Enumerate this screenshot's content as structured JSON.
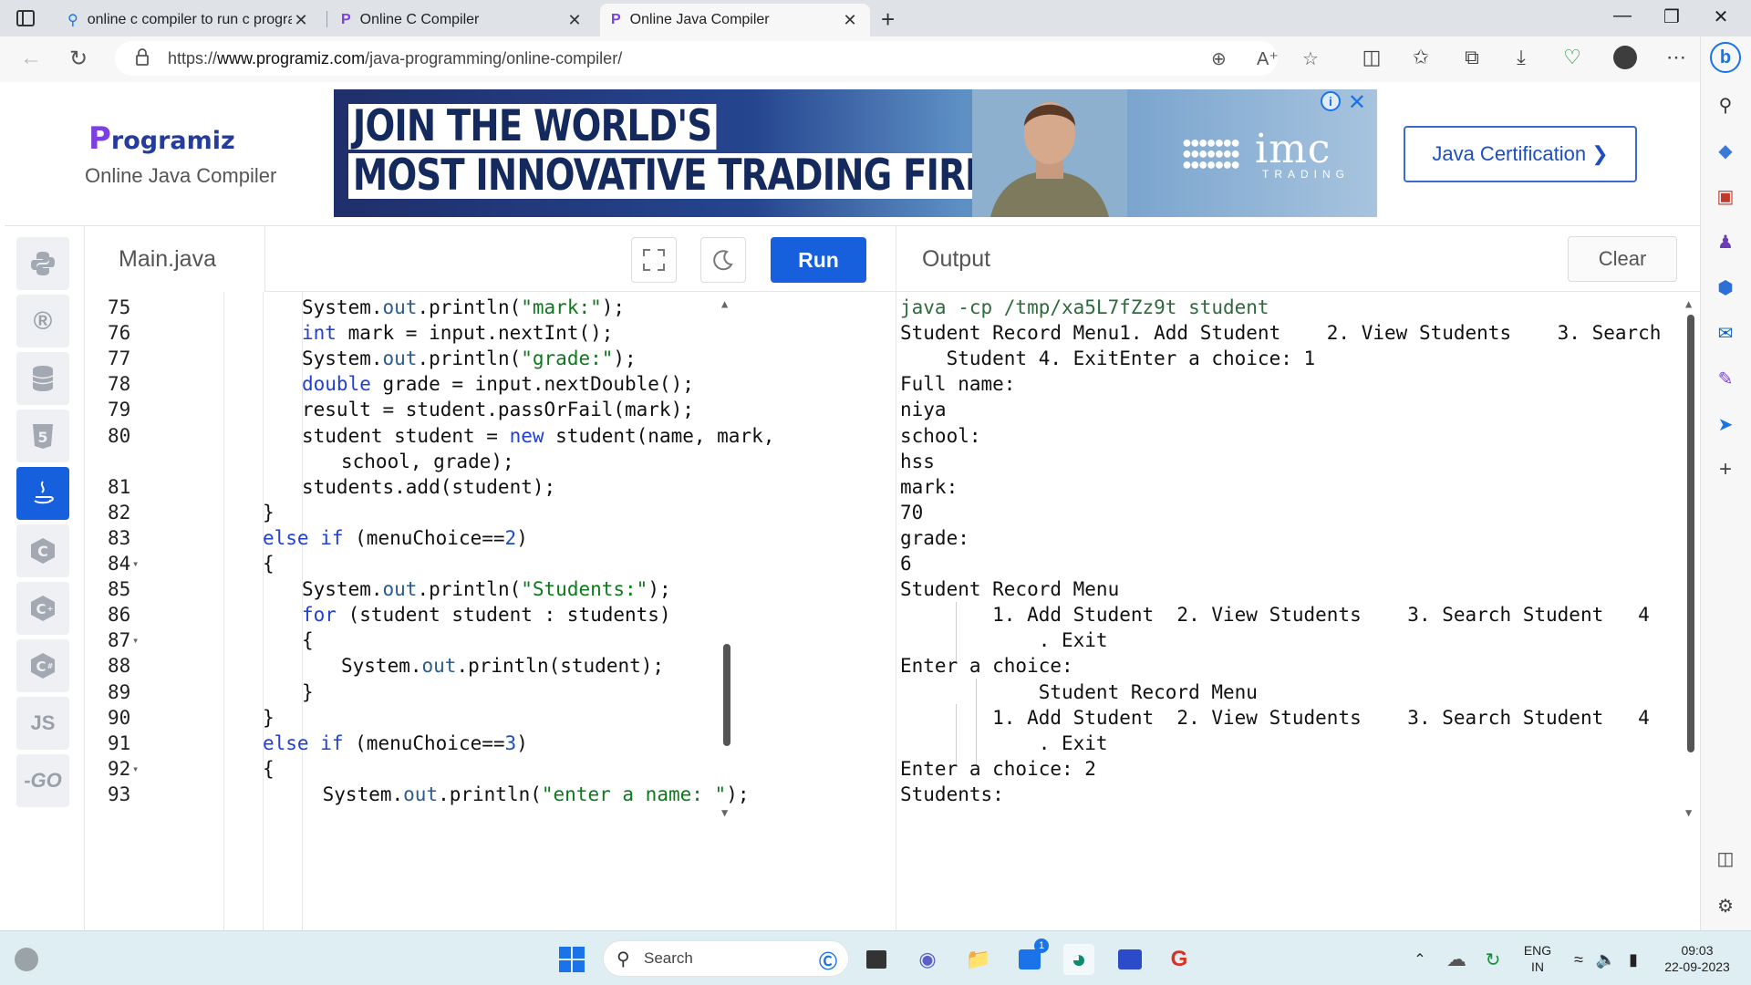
{
  "browser": {
    "tabs": [
      {
        "title": "online c compiler to run c progra",
        "close": "✕"
      },
      {
        "title": "Online C Compiler",
        "close": "✕"
      },
      {
        "title": "Online Java Compiler",
        "close": "✕"
      }
    ],
    "new_tab": "+",
    "url_prefix": "https://",
    "url_host": "www.programiz.com",
    "url_path": "/java-programming/online-compiler/",
    "window": {
      "minimize": "—",
      "maximize": "❐",
      "close": "✕"
    }
  },
  "header": {
    "logo_p": "P",
    "logo_rest": "rogramiz",
    "subtitle": "Online Java Compiler",
    "ad": {
      "line1": "JOIN THE WORLD'S",
      "line2": "MOST INNOVATIVE TRADING FIRM",
      "brand": "imc",
      "brand_sub": "TRADING",
      "info": "i",
      "close": "✕"
    },
    "cert_button": "Java Certification ❯"
  },
  "languages": [
    "python",
    "r",
    "sql",
    "html5",
    "java",
    "c",
    "cpp",
    "csharp",
    "js",
    "go"
  ],
  "lang_labels": {
    "js": "JS",
    "go": "-GO"
  },
  "editor": {
    "filename": "Main.java",
    "run_label": "Run",
    "lines": [
      {
        "num": "75",
        "fold": ""
      },
      {
        "num": "76",
        "fold": ""
      },
      {
        "num": "77",
        "fold": ""
      },
      {
        "num": "78",
        "fold": ""
      },
      {
        "num": "79",
        "fold": ""
      },
      {
        "num": "80",
        "fold": ""
      },
      {
        "num": "",
        "fold": ""
      },
      {
        "num": "81",
        "fold": ""
      },
      {
        "num": "82",
        "fold": ""
      },
      {
        "num": "83",
        "fold": ""
      },
      {
        "num": "84",
        "fold": "▾"
      },
      {
        "num": "85",
        "fold": ""
      },
      {
        "num": "86",
        "fold": ""
      },
      {
        "num": "87",
        "fold": "▾"
      },
      {
        "num": "88",
        "fold": ""
      },
      {
        "num": "89",
        "fold": ""
      },
      {
        "num": "90",
        "fold": ""
      },
      {
        "num": "91",
        "fold": ""
      },
      {
        "num": "92",
        "fold": "▾"
      },
      {
        "num": "93",
        "fold": ""
      }
    ],
    "code": [
      [
        [
          "",
          "System"
        ],
        [
          "",
          "."
        ],
        [
          "fn",
          "out"
        ],
        [
          "",
          ".println("
        ],
        [
          "str",
          "\"mark:\""
        ],
        [
          "",
          ");"
        ]
      ],
      [
        [
          "kw",
          "int"
        ],
        [
          "",
          " mark = input.nextInt();"
        ]
      ],
      [
        [
          "",
          "System."
        ],
        [
          "fn",
          "out"
        ],
        [
          "",
          ".println("
        ],
        [
          "str",
          "\"grade:\""
        ],
        [
          "",
          ");"
        ]
      ],
      [
        [
          "kw",
          "double"
        ],
        [
          "",
          " grade = input.nextDouble();"
        ]
      ],
      [
        [
          "",
          "result = student.passOrFail(mark);"
        ]
      ],
      [
        [
          "",
          "student student = "
        ],
        [
          "kw",
          "new"
        ],
        [
          "",
          " student(name, mark,"
        ]
      ],
      [
        [
          "",
          "school, grade);"
        ]
      ],
      [
        [
          "",
          "students.add(student);"
        ]
      ],
      [
        [
          "",
          "}"
        ]
      ],
      [
        [
          "kw",
          "else if"
        ],
        [
          "",
          " (menuChoice=="
        ],
        [
          "num",
          "2"
        ],
        [
          "",
          ")"
        ]
      ],
      [
        [
          "",
          "{"
        ]
      ],
      [
        [
          "",
          "System."
        ],
        [
          "fn",
          "out"
        ],
        [
          "",
          ".println("
        ],
        [
          "str",
          "\"Students:\""
        ],
        [
          "",
          ");"
        ]
      ],
      [
        [
          "kw",
          "for"
        ],
        [
          "",
          " (student student : students)"
        ]
      ],
      [
        [
          "",
          "{"
        ]
      ],
      [
        [
          "",
          "System."
        ],
        [
          "fn",
          "out"
        ],
        [
          "",
          ".println(student);"
        ]
      ],
      [
        [
          "",
          "}"
        ]
      ],
      [
        [
          "",
          "}"
        ]
      ],
      [
        [
          "kw",
          "else if"
        ],
        [
          "",
          " (menuChoice=="
        ],
        [
          "num",
          "3"
        ],
        [
          "",
          ")"
        ]
      ],
      [
        [
          "",
          "{"
        ]
      ],
      [
        [
          "",
          " System."
        ],
        [
          "fn",
          "out"
        ],
        [
          "",
          ".println("
        ],
        [
          "str",
          "\"enter a name: \""
        ],
        [
          "",
          ");"
        ]
      ]
    ]
  },
  "output": {
    "title": "Output",
    "clear_label": "Clear",
    "lines": [
      "java -cp /tmp/xa5L7fZz9t student",
      "Student Record Menu1. Add Student    2. View Students    3. Search",
      "    Student 4. ExitEnter a choice: 1",
      "Full name:",
      "niya",
      "school:",
      "hss",
      "mark:",
      "70",
      "grade:",
      "6",
      "Student Record Menu",
      "        1. Add Student  2. View Students    3. Search Student   4",
      "            . Exit",
      "Enter a choice:",
      "            Student Record Menu",
      "        1. Add Student  2. View Students    3. Search Student   4",
      "            . Exit",
      "Enter a choice: 2",
      "Students:"
    ]
  },
  "taskbar": {
    "search_label": "Search",
    "lang_line1": "ENG",
    "lang_line2": "IN",
    "time": "09:03",
    "date": "22-09-2023",
    "store_badge": "1"
  },
  "colors": {
    "accent": "#1660dd",
    "brand": "#243c9e"
  }
}
